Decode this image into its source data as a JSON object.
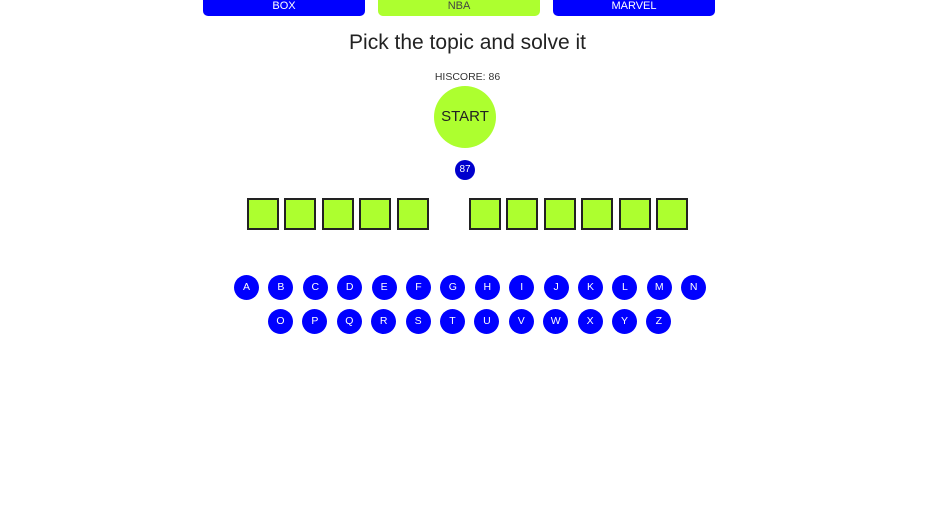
{
  "topics": [
    {
      "label": "BOX",
      "active": false
    },
    {
      "label": "NBA",
      "active": true
    },
    {
      "label": "MARVEL",
      "active": false
    }
  ],
  "colors": {
    "primary_blue": "#0000ff",
    "accent_green": "#adff2f"
  },
  "heading": "Pick the topic and solve it",
  "hiscore_label": "HISCORE: 86",
  "start_label": "START",
  "counter_value": "87",
  "word_groups": [
    5,
    6
  ],
  "keyboard": {
    "row1": [
      "A",
      "B",
      "C",
      "D",
      "E",
      "F",
      "G",
      "H",
      "I",
      "J",
      "K",
      "L",
      "M",
      "N"
    ],
    "row2": [
      "O",
      "P",
      "Q",
      "R",
      "S",
      "T",
      "U",
      "V",
      "W",
      "X",
      "Y",
      "Z"
    ]
  }
}
